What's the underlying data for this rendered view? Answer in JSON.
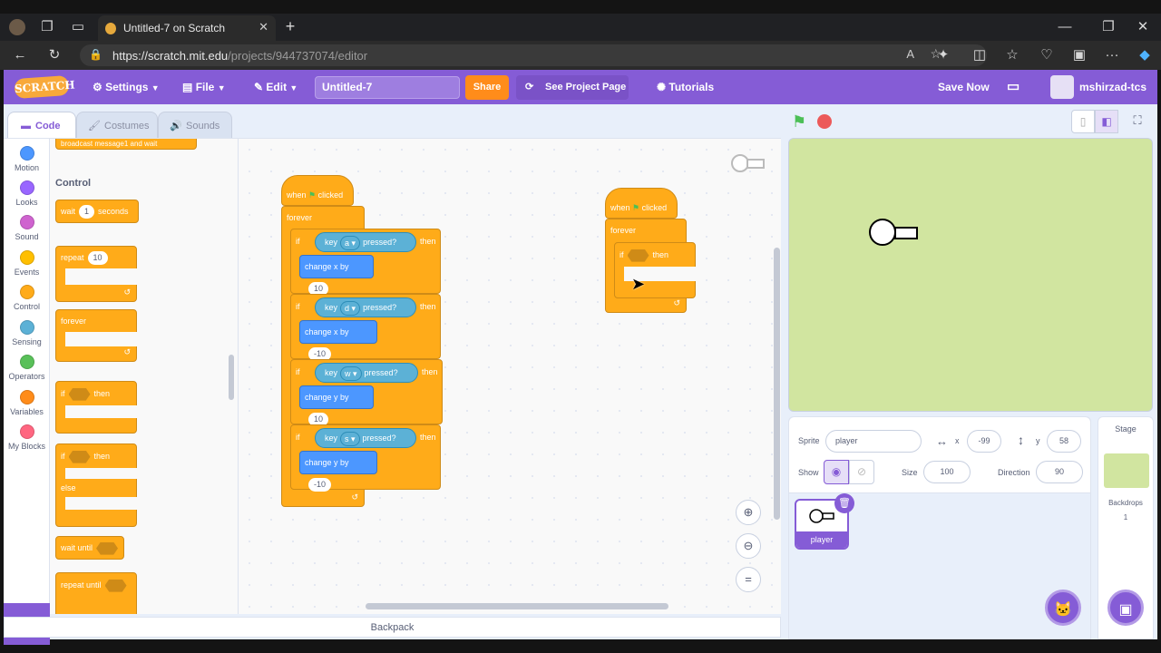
{
  "browser": {
    "tab_title": "Untitled-7 on Scratch",
    "url_host": "https://scratch.mit.edu",
    "url_path": "/projects/944737074/editor"
  },
  "menu": {
    "logo": "SCRATCH",
    "settings": "Settings",
    "file": "File",
    "edit": "Edit",
    "project_title": "Untitled-7",
    "share": "Share",
    "see_project": "See Project Page",
    "tutorials": "Tutorials",
    "save_now": "Save Now",
    "username": "mshirzad-tcs"
  },
  "editor_tabs": [
    "Code",
    "Costumes",
    "Sounds"
  ],
  "categories": [
    {
      "label": "Motion",
      "color": "#4c97ff"
    },
    {
      "label": "Looks",
      "color": "#9966ff"
    },
    {
      "label": "Sound",
      "color": "#cf63cf"
    },
    {
      "label": "Events",
      "color": "#ffbf00"
    },
    {
      "label": "Control",
      "color": "#ffab19"
    },
    {
      "label": "Sensing",
      "color": "#5cb1d6"
    },
    {
      "label": "Operators",
      "color": "#59c059"
    },
    {
      "label": "Variables",
      "color": "#ff8c1a"
    },
    {
      "label": "My Blocks",
      "color": "#ff6680"
    }
  ],
  "palette": {
    "section_label": "Control",
    "top_partial": "broadcast message1 and wait",
    "wait": {
      "prefix": "wait",
      "value": "1",
      "suffix": "seconds"
    },
    "repeat": {
      "prefix": "repeat",
      "value": "10"
    },
    "forever": "forever",
    "if_then": {
      "if": "if",
      "then": "then"
    },
    "if_else": {
      "if": "if",
      "then": "then",
      "else": "else"
    },
    "wait_until": "wait until",
    "repeat_until": "repeat until"
  },
  "script1": {
    "hat": {
      "when": "when",
      "clicked": "clicked"
    },
    "forever": "forever",
    "ifs": [
      {
        "if": "if",
        "key": "key",
        "keyval": "a",
        "pressed": "pressed?",
        "then": "then",
        "action": "change x by",
        "value": "10"
      },
      {
        "if": "if",
        "key": "key",
        "keyval": "d",
        "pressed": "pressed?",
        "then": "then",
        "action": "change x by",
        "value": "-10"
      },
      {
        "if": "if",
        "key": "key",
        "keyval": "w",
        "pressed": "pressed?",
        "then": "then",
        "action": "change y by",
        "value": "10"
      },
      {
        "if": "if",
        "key": "key",
        "keyval": "s",
        "pressed": "pressed?",
        "then": "then",
        "action": "change y by",
        "value": "-10"
      }
    ]
  },
  "script2": {
    "hat": {
      "when": "when",
      "clicked": "clicked"
    },
    "forever": "forever",
    "if": "if",
    "then": "then"
  },
  "backpack": "Backpack",
  "sprite_info": {
    "sprite_label": "Sprite",
    "sprite_name": "player",
    "x_label": "x",
    "x_value": "-99",
    "y_label": "y",
    "y_value": "58",
    "show_label": "Show",
    "size_label": "Size",
    "size_value": "100",
    "direction_label": "Direction",
    "direction_value": "90"
  },
  "sprite_thumb_name": "player",
  "stage_pane": {
    "title": "Stage",
    "backdrops_label": "Backdrops",
    "backdrops_count": "1"
  },
  "colors": {
    "scratch_purple": "#855cd6",
    "control": "#ffab19",
    "motion": "#4c97ff",
    "sensing": "#5cb1d6",
    "stage_bg": "#d1e5a0"
  }
}
